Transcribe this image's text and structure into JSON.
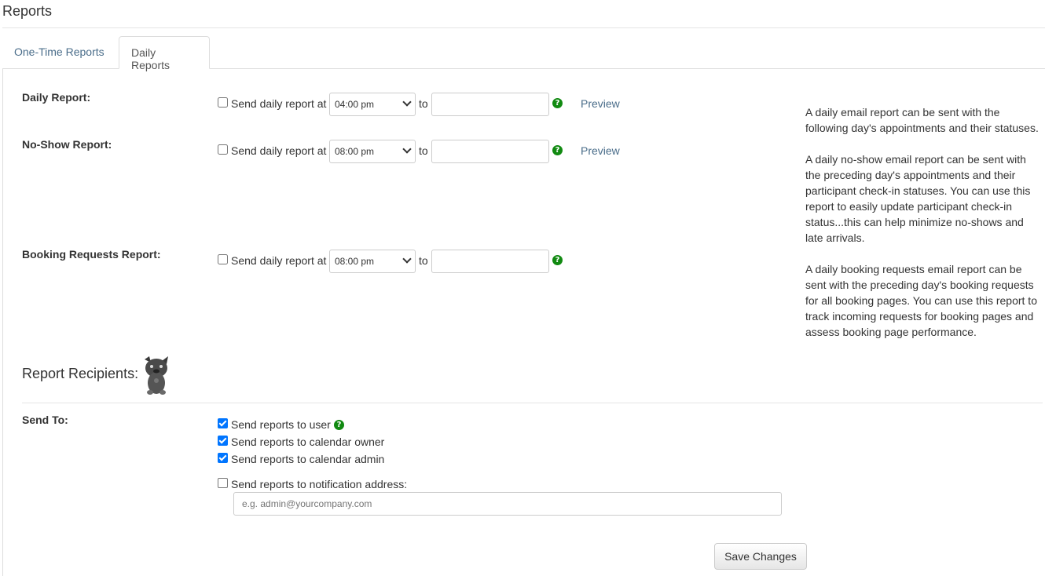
{
  "page_title": "Reports",
  "tabs": [
    {
      "label": "One-Time Reports",
      "active": false
    },
    {
      "label": "Daily Reports",
      "active": true
    }
  ],
  "reports": [
    {
      "label": "Daily Report:",
      "checkbox_text": "Send daily report at",
      "time": "04:00 pm",
      "to_text": "to",
      "to_value": "",
      "preview": "Preview"
    },
    {
      "label": "No-Show Report:",
      "checkbox_text": "Send daily report at",
      "time": "08:00 pm",
      "to_text": "to",
      "to_value": "",
      "preview": "Preview"
    },
    {
      "label": "Booking Requests Report:",
      "checkbox_text": "Send daily report at",
      "time": "08:00 pm",
      "to_text": "to",
      "to_value": ""
    }
  ],
  "help_glyph": "?",
  "info": {
    "daily": "A daily email report can be sent with the following day's appointments and their statuses.",
    "noshow": "A daily no-show email report can be sent with the preceding day's appointments and their participant check-in statuses. You can use this report to easily update participant check-in status...this can help minimize no-shows and late arrivals.",
    "booking": "A daily booking requests email report can be sent with the preceding day's booking requests for all booking pages. You can use this report to track incoming requests for booking pages and assess booking page performance."
  },
  "recipients": {
    "title": "Report Recipients:",
    "send_to_label": "Send To:",
    "options": [
      {
        "label": "Send reports to user",
        "checked": true
      },
      {
        "label": "Send reports to calendar owner",
        "checked": true
      },
      {
        "label": "Send reports to calendar admin",
        "checked": true
      },
      {
        "label": "Send reports to notification address:",
        "checked": false
      }
    ],
    "email_placeholder": "e.g. admin@yourcompany.com"
  },
  "save_label": "Save Changes",
  "colors": {
    "link": "#4a6d8a",
    "help": "#118a11",
    "checkbox": "#0075ff"
  },
  "icons": {
    "help": "question-circle-icon",
    "mascot": "cat-mascot-icon"
  }
}
